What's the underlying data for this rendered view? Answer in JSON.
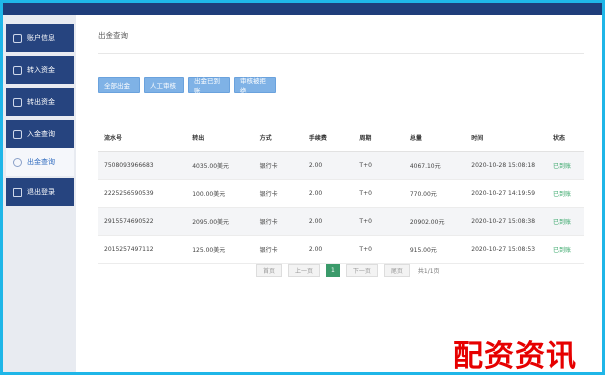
{
  "header": {
    "title_faded": ""
  },
  "sidebar": {
    "items": [
      {
        "label": "账户信息",
        "icon": "user-icon"
      },
      {
        "label": "转入资金",
        "icon": "deposit-icon"
      },
      {
        "label": "转出资金",
        "icon": "withdraw-icon"
      },
      {
        "label": "入金查询",
        "icon": "query-icon"
      },
      {
        "label": "出金查询",
        "icon": "search-icon",
        "active": true
      },
      {
        "label": "退出登录",
        "icon": "logout-icon"
      }
    ]
  },
  "main": {
    "title": "出金查询",
    "filters": [
      "全部出金",
      "人工审核",
      "出金已到账",
      "审核被拒绝"
    ],
    "table": {
      "columns": [
        "流水号",
        "转出",
        "方式",
        "手续费",
        "周期",
        "总量",
        "时间",
        "状态"
      ],
      "rows": [
        [
          "7508093966683",
          "4035.00美元",
          "银行卡",
          "2.00",
          "T+0",
          "4067.10元",
          "2020-10-28 15:08:18",
          "已到账"
        ],
        [
          "2225256590539",
          "100.00美元",
          "银行卡",
          "2.00",
          "T+0",
          "770.00元",
          "2020-10-27 14:19:59",
          "已到账"
        ],
        [
          "2915574690522",
          "2095.00美元",
          "银行卡",
          "2.00",
          "T+0",
          "20902.00元",
          "2020-10-27 15:08:38",
          "已到账"
        ],
        [
          "2015257497112",
          "125.00美元",
          "银行卡",
          "2.00",
          "T+0",
          "915.00元",
          "2020-10-27 15:08:53",
          "已到账"
        ]
      ]
    },
    "pagination": {
      "first": "首页",
      "prev": "上一页",
      "current": "1",
      "next": "下一页",
      "last": "尾页",
      "summary": "共1/1页"
    }
  },
  "watermark": "配资资讯",
  "colors": {
    "sidebar_bg": "#26447f",
    "filter_button": "#7fb2e6",
    "status_ok": "#3aa86b",
    "page_current": "#3a9a6a",
    "watermark": "#e60000"
  }
}
